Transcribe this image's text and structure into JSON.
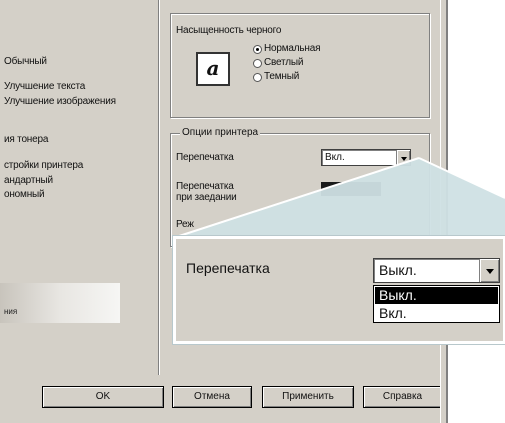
{
  "left_panel": {
    "items": [
      "Обычный",
      "Улучшение текста",
      "Улучшение изображения",
      "ия тонера",
      "стройки принтера",
      "андартный",
      "ономный"
    ],
    "strip_text": "ния"
  },
  "black_saturation": {
    "title": "Насыщенность черного",
    "options": [
      "Нормальная",
      "Светлый",
      "Темный"
    ],
    "selected": "Нормальная",
    "icon_letter": "a"
  },
  "printer_options": {
    "title": "Опции принтера",
    "reprint_label": "Перепечатка",
    "reprint_value": "Вкл.",
    "jam_label": "Перепечатка при заедании",
    "partial_label": "Реж"
  },
  "zoom": {
    "label": "Перепечатка",
    "value": "Выкл.",
    "options": [
      "Выкл.",
      "Вкл."
    ],
    "selected": "Выкл."
  },
  "buttons": {
    "ok": "OK",
    "cancel": "Отмена",
    "apply": "Применить",
    "help": "Справка"
  },
  "colors": {
    "dialog_bg": "#d4d0c8",
    "zoom_beam": "#cfe0e4",
    "zoom_border": "#ffffff",
    "selection": "#000000"
  }
}
